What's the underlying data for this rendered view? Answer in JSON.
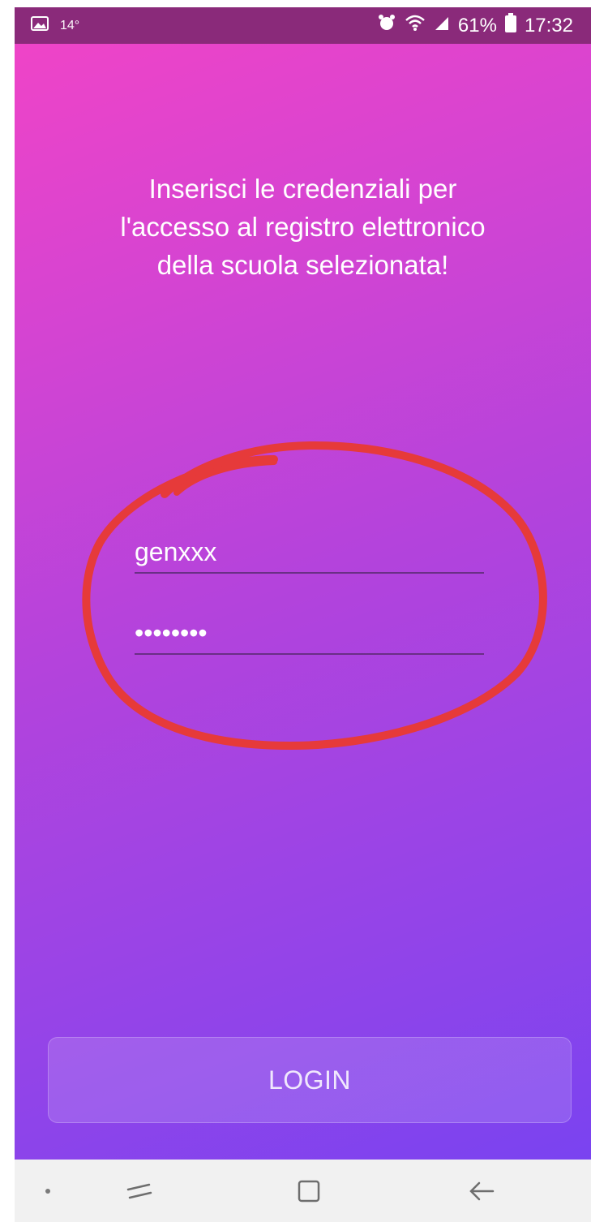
{
  "status_bar": {
    "temperature": "14°",
    "battery_percent": "61%",
    "time": "17:32",
    "icons": [
      "image-icon",
      "alarm-icon",
      "wifi-icon",
      "signal-icon",
      "battery-icon"
    ]
  },
  "login": {
    "prompt": "Inserisci le credenziali per\nl'accesso al registro elettronico\ndella scuola selezionata!",
    "username_value": "genxxx",
    "password_value": "••••••••",
    "login_button": "LOGIN"
  },
  "navigation": {
    "items": [
      "dot-icon",
      "recent-apps-icon",
      "home-icon",
      "back-icon"
    ]
  },
  "colors": {
    "gradient_top": "#f244c6",
    "gradient_bottom": "#7a43f0",
    "annotation": "#e63a3a",
    "status_bar": "#8a2a7a"
  }
}
